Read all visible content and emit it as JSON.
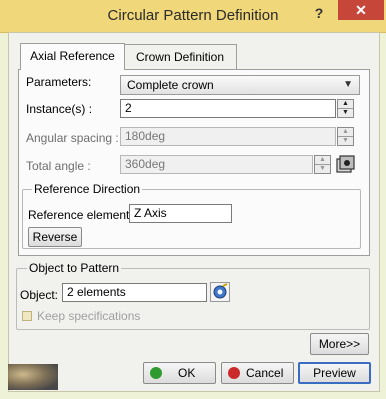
{
  "window": {
    "title": "Circular Pattern Definition",
    "help_label": "?",
    "close_label": "✕"
  },
  "tabs": [
    {
      "label": "Axial Reference",
      "active": true
    },
    {
      "label": "Crown Definition",
      "active": false
    }
  ],
  "axial": {
    "parameters_label": "Parameters:",
    "parameters_value": "Complete crown",
    "instances_label": "Instance(s) :",
    "instances_value": "2",
    "angular_label": "Angular spacing :",
    "angular_value": "180deg",
    "total_label": "Total angle :",
    "total_value": "360deg"
  },
  "reference_direction": {
    "title": "Reference Direction",
    "element_label": "Reference element:",
    "element_value": "Z Axis",
    "reverse_label": "Reverse"
  },
  "object_to_pattern": {
    "title": "Object to Pattern",
    "object_label": "Object:",
    "object_value": "2 elements",
    "keep_label": "Keep specifications",
    "keep_checked": false
  },
  "buttons": {
    "more": "More>>",
    "ok": "OK",
    "cancel": "Cancel",
    "preview": "Preview"
  },
  "colors": {
    "ok_dot": "#2f9a2f",
    "cancel_dot": "#cc2a2a",
    "titlebar": "#f0d77a",
    "close": "#c7463a"
  }
}
